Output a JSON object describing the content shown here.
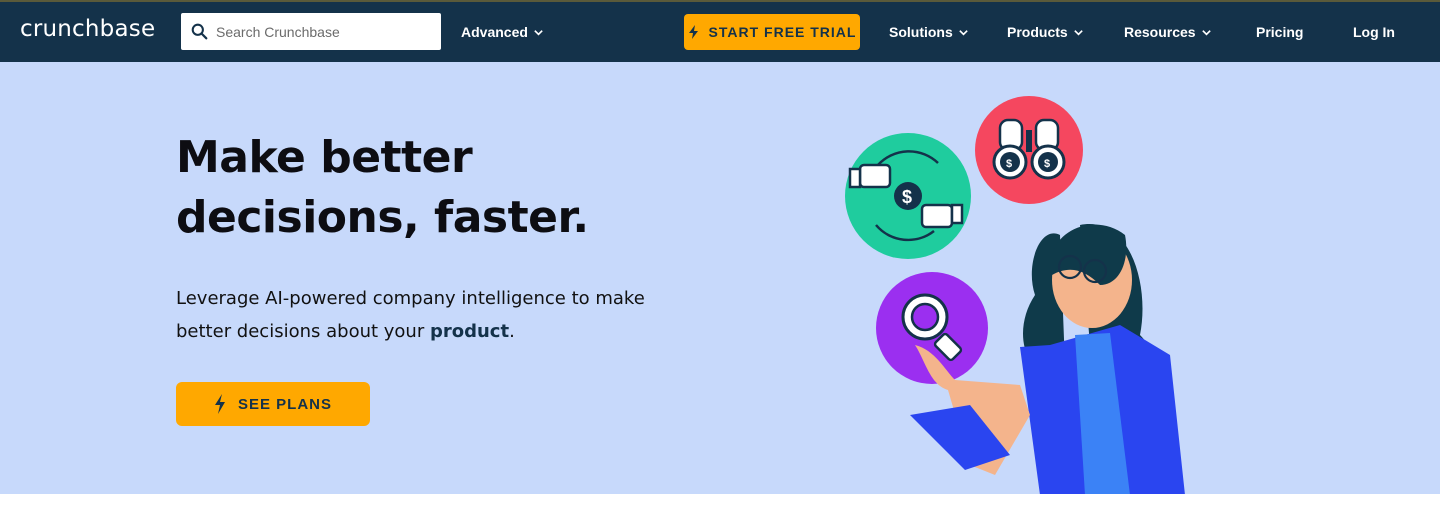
{
  "brand": {
    "logo_text": "crunchbase"
  },
  "search": {
    "placeholder": "Search Crunchbase",
    "icon": "search-icon"
  },
  "nav": {
    "advanced": "Advanced",
    "trial_button": "START FREE TRIAL",
    "solutions": "Solutions",
    "products": "Products",
    "resources": "Resources",
    "pricing": "Pricing",
    "login": "Log In"
  },
  "hero": {
    "title_line1": "Make better",
    "title_line2": "decisions, faster.",
    "subtitle_part1": "Leverage AI-powered company intelligence to make better decisions about your ",
    "subtitle_emphasis": "product",
    "subtitle_end": ".",
    "cta_label": "SEE PLANS"
  },
  "colors": {
    "nav_bg": "#14324a",
    "accent": "#ffa800",
    "hero_bg": "#c7d9fb",
    "teal_circle": "#1fcc9e",
    "red_circle": "#f5475f",
    "purple_circle": "#9b2ff0",
    "jacket_blue": "#2a45f0"
  }
}
